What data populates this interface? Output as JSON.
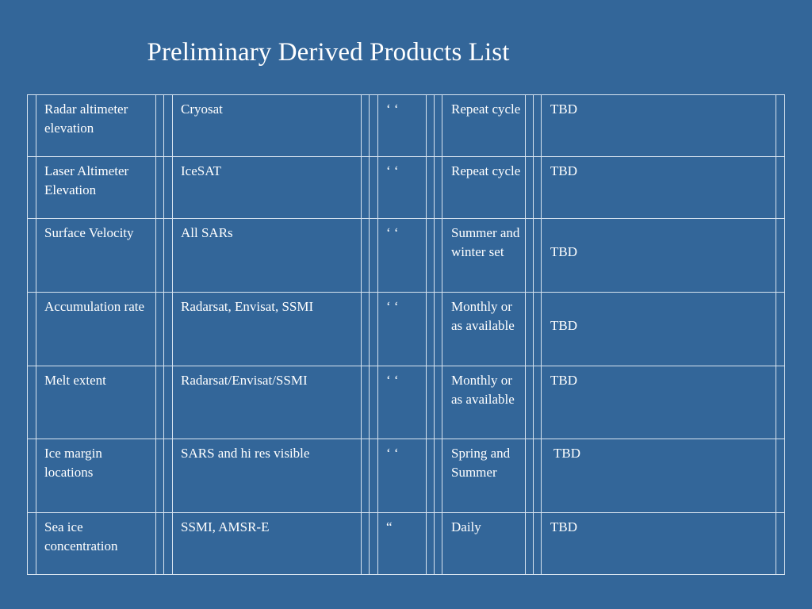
{
  "title": "Preliminary Derived Products List",
  "table": {
    "rows": [
      {
        "product": "Radar altimeter elevation",
        "sensor": "Cryosat",
        "ditto": "‘ ‘",
        "frequency": "Repeat cycle",
        "status": "TBD"
      },
      {
        "product": "Laser Altimeter Elevation",
        "sensor": "IceSAT",
        "ditto": "‘ ‘",
        "frequency": "Repeat cycle",
        "status": "TBD"
      },
      {
        "product": "Surface Velocity",
        "sensor": "All SARs",
        "ditto": "‘ ‘",
        "frequency": "Summer and winter set",
        "status": "TBD"
      },
      {
        "product": "Accumulation rate",
        "sensor": "Radarsat, Envisat, SSMI",
        "ditto": "‘ ‘",
        "frequency": "Monthly or as available",
        "status": "TBD"
      },
      {
        "product": "Melt extent",
        "sensor": "Radarsat/Envisat/SSMI",
        "ditto": "‘ ‘",
        "frequency": "Monthly or as available",
        "status": "TBD"
      },
      {
        "product": "Ice margin locations",
        "sensor": "SARS and hi res visible",
        "ditto": "‘ ‘",
        "frequency": "Spring and Summer",
        "status": "TBD"
      },
      {
        "product": "Sea ice concentration",
        "sensor": "SSMI, AMSR-E",
        "ditto": "“",
        "frequency": "Daily",
        "status": "TBD"
      }
    ]
  }
}
